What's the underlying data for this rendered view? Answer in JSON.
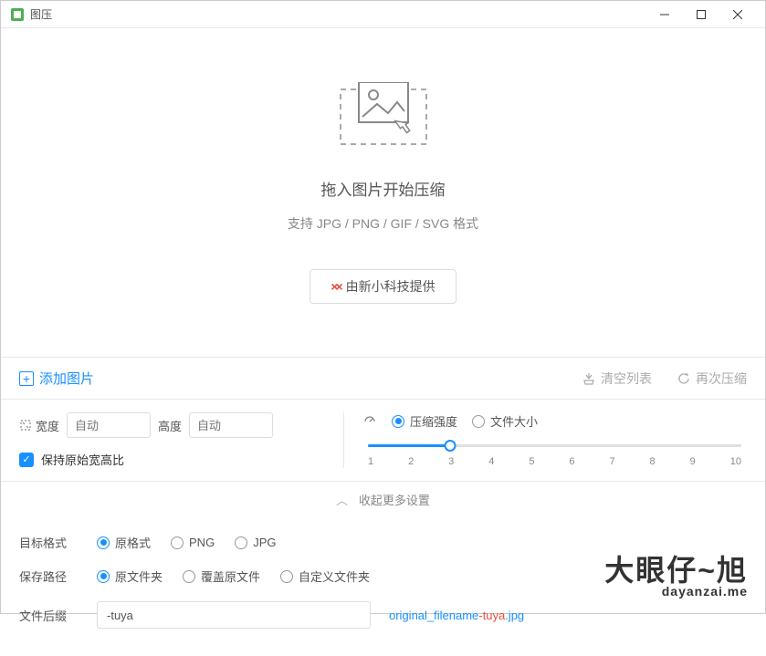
{
  "window": {
    "title": "图压"
  },
  "drop": {
    "title": "拖入图片开始压缩",
    "subtitle": "支持 JPG / PNG / GIF / SVG 格式",
    "provider": "由新小科技提供"
  },
  "actions": {
    "add": "添加图片",
    "clear": "清空列表",
    "recompress": "再次压缩"
  },
  "dimensions": {
    "width_label": "宽度",
    "width_placeholder": "自动",
    "height_label": "高度",
    "height_placeholder": "自动",
    "keep_ratio": "保持原始宽高比"
  },
  "compress": {
    "mode_strength": "压缩强度",
    "mode_filesize": "文件大小",
    "slider_value": 3,
    "ticks": [
      "1",
      "2",
      "3",
      "4",
      "5",
      "6",
      "7",
      "8",
      "9",
      "10"
    ]
  },
  "collapse": {
    "label": "收起更多设置"
  },
  "format": {
    "label": "目标格式",
    "options": [
      "原格式",
      "PNG",
      "JPG"
    ],
    "selected": "原格式"
  },
  "save": {
    "label": "保存路径",
    "options": [
      "原文件夹",
      "覆盖原文件",
      "自定义文件夹"
    ],
    "selected": "原文件夹"
  },
  "suffix": {
    "label": "文件后缀",
    "value": "-tuya",
    "preview_prefix": "original_filename",
    "preview_suffix": "-tuya",
    "preview_ext": ".jpg"
  },
  "watermark": {
    "cn": "大眼仔~旭",
    "en": "dayanzai.me"
  }
}
